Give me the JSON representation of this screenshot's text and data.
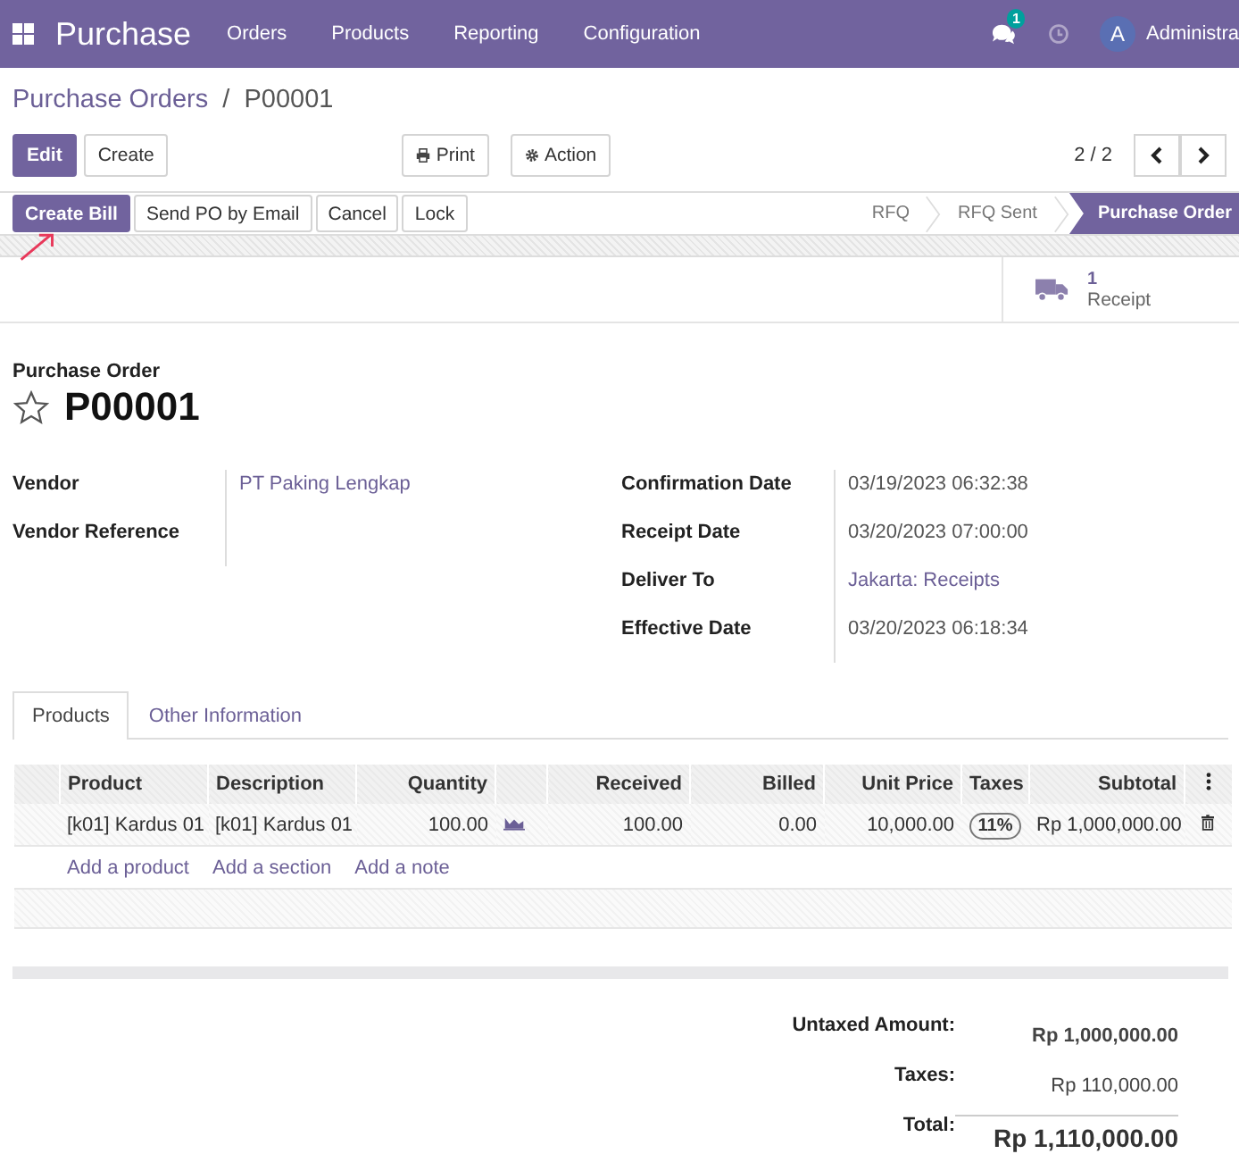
{
  "nav": {
    "app": "Purchase",
    "menus": [
      "Orders",
      "Products",
      "Reporting",
      "Configuration"
    ],
    "message_count": "1",
    "avatar": "A",
    "user": "Administra"
  },
  "breadcrumb": {
    "parent": "Purchase Orders",
    "separator": "/",
    "current": "P00001"
  },
  "control_buttons": [
    {
      "label": "Edit",
      "kind": "primary"
    },
    {
      "label": "Create",
      "kind": "secondary"
    }
  ],
  "actions": [
    {
      "label": "Print",
      "kind": "print"
    },
    {
      "label": "Action",
      "kind": "gear"
    }
  ],
  "pager": "2 / 2",
  "header_buttons": [
    {
      "label": "Create Bill",
      "kind": "primary"
    },
    {
      "label": "Send PO by Email",
      "kind": "secondary"
    },
    {
      "label": "Cancel",
      "kind": "secondary"
    },
    {
      "label": "Lock",
      "kind": "secondary"
    }
  ],
  "stages": [
    {
      "label": "RFQ",
      "selected": false
    },
    {
      "label": "RFQ Sent",
      "selected": false
    },
    {
      "label": "Purchase Order",
      "selected": true
    }
  ],
  "smart_button": {
    "count": "1",
    "label": "Receipt"
  },
  "title": {
    "caption": "Purchase Order",
    "name": "P00001",
    "starred": false
  },
  "left_fields": [
    {
      "label": "Vendor",
      "value": "PT Paking Lengkap",
      "kind": "link"
    },
    {
      "label": "Vendor Reference",
      "kind": "empty"
    }
  ],
  "right_fields": [
    {
      "label": "Confirmation Date",
      "value": "03/19/2023 06:32:38",
      "kind": "text"
    },
    {
      "label": "Receipt Date",
      "value": "03/20/2023 07:00:00",
      "kind": "text"
    },
    {
      "label": "Deliver To",
      "value": "Jakarta: Receipts",
      "kind": "link"
    },
    {
      "label": "Effective Date",
      "value": "03/20/2023 06:18:34",
      "kind": "text"
    }
  ],
  "tabs": [
    {
      "label": "Products",
      "selected": true
    },
    {
      "label": "Other Information",
      "selected": false
    }
  ],
  "table": {
    "columns": [
      "Product",
      "Description",
      "Quantity",
      "Received",
      "Billed",
      "Unit Price",
      "Taxes",
      "Subtotal"
    ],
    "rows": [
      {
        "cells": [
          "[k01] Kardus 01",
          "[k01] Kardus 01",
          "100.00",
          "100.00",
          "0.00",
          "10,000.00",
          "11%",
          "Rp 1,000,000.00"
        ]
      }
    ],
    "add_links": [
      "Add a product",
      "Add a section",
      "Add a note"
    ]
  },
  "totals": [
    {
      "label": "Untaxed Amount:",
      "value": "Rp 1,000,000.00",
      "kind": "untaxed"
    },
    {
      "label": "Taxes:",
      "value": "Rp 110,000.00",
      "kind": "tax"
    },
    {
      "label": "Total:",
      "value": "Rp 1,110,000.00",
      "kind": "total"
    }
  ]
}
